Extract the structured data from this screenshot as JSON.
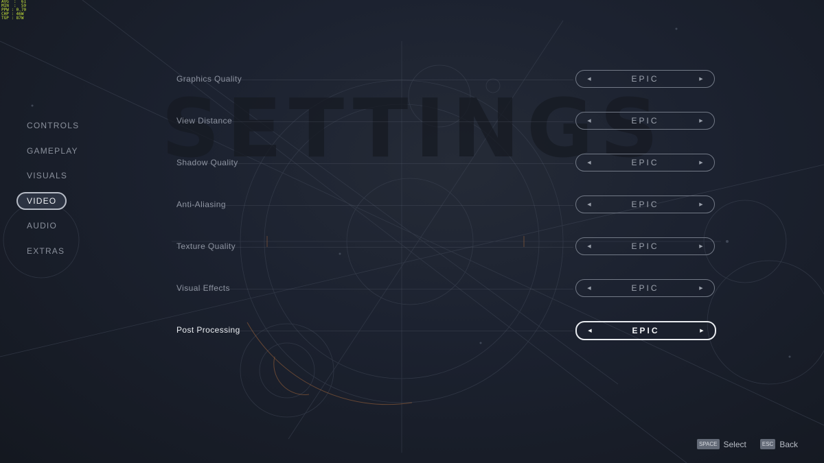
{
  "perf_overlay": [
    "AVG  :  61",
    "MIN  :  59",
    "PPW : 0.70",
    "CHP : 46W",
    "TGP : 87W"
  ],
  "watermark": "SETTINGS",
  "nav": {
    "items": [
      {
        "label": "CONTROLS"
      },
      {
        "label": "GAMEPLAY"
      },
      {
        "label": "VISUALS"
      },
      {
        "label": "VIDEO",
        "active": true
      },
      {
        "label": "AUDIO"
      },
      {
        "label": "EXTRAS"
      }
    ]
  },
  "settings": [
    {
      "label": "Graphics Quality",
      "value": "EPIC"
    },
    {
      "label": "View Distance",
      "value": "EPIC"
    },
    {
      "label": "Shadow Quality",
      "value": "EPIC"
    },
    {
      "label": "Anti-Aliasing",
      "value": "EPIC"
    },
    {
      "label": "Texture Quality",
      "value": "EPIC"
    },
    {
      "label": "Visual Effects",
      "value": "EPIC"
    },
    {
      "label": "Post Processing",
      "value": "EPIC",
      "focused": true
    }
  ],
  "icons": {
    "left": "chevron-left-icon",
    "right": "chevron-right-icon"
  },
  "footer": {
    "select_key": "SPACE",
    "select_label": "Select",
    "back_key": "ESC",
    "back_label": "Back"
  },
  "colors": {
    "accent_line": "#a8683a",
    "active_border": "#e9ecf0"
  }
}
